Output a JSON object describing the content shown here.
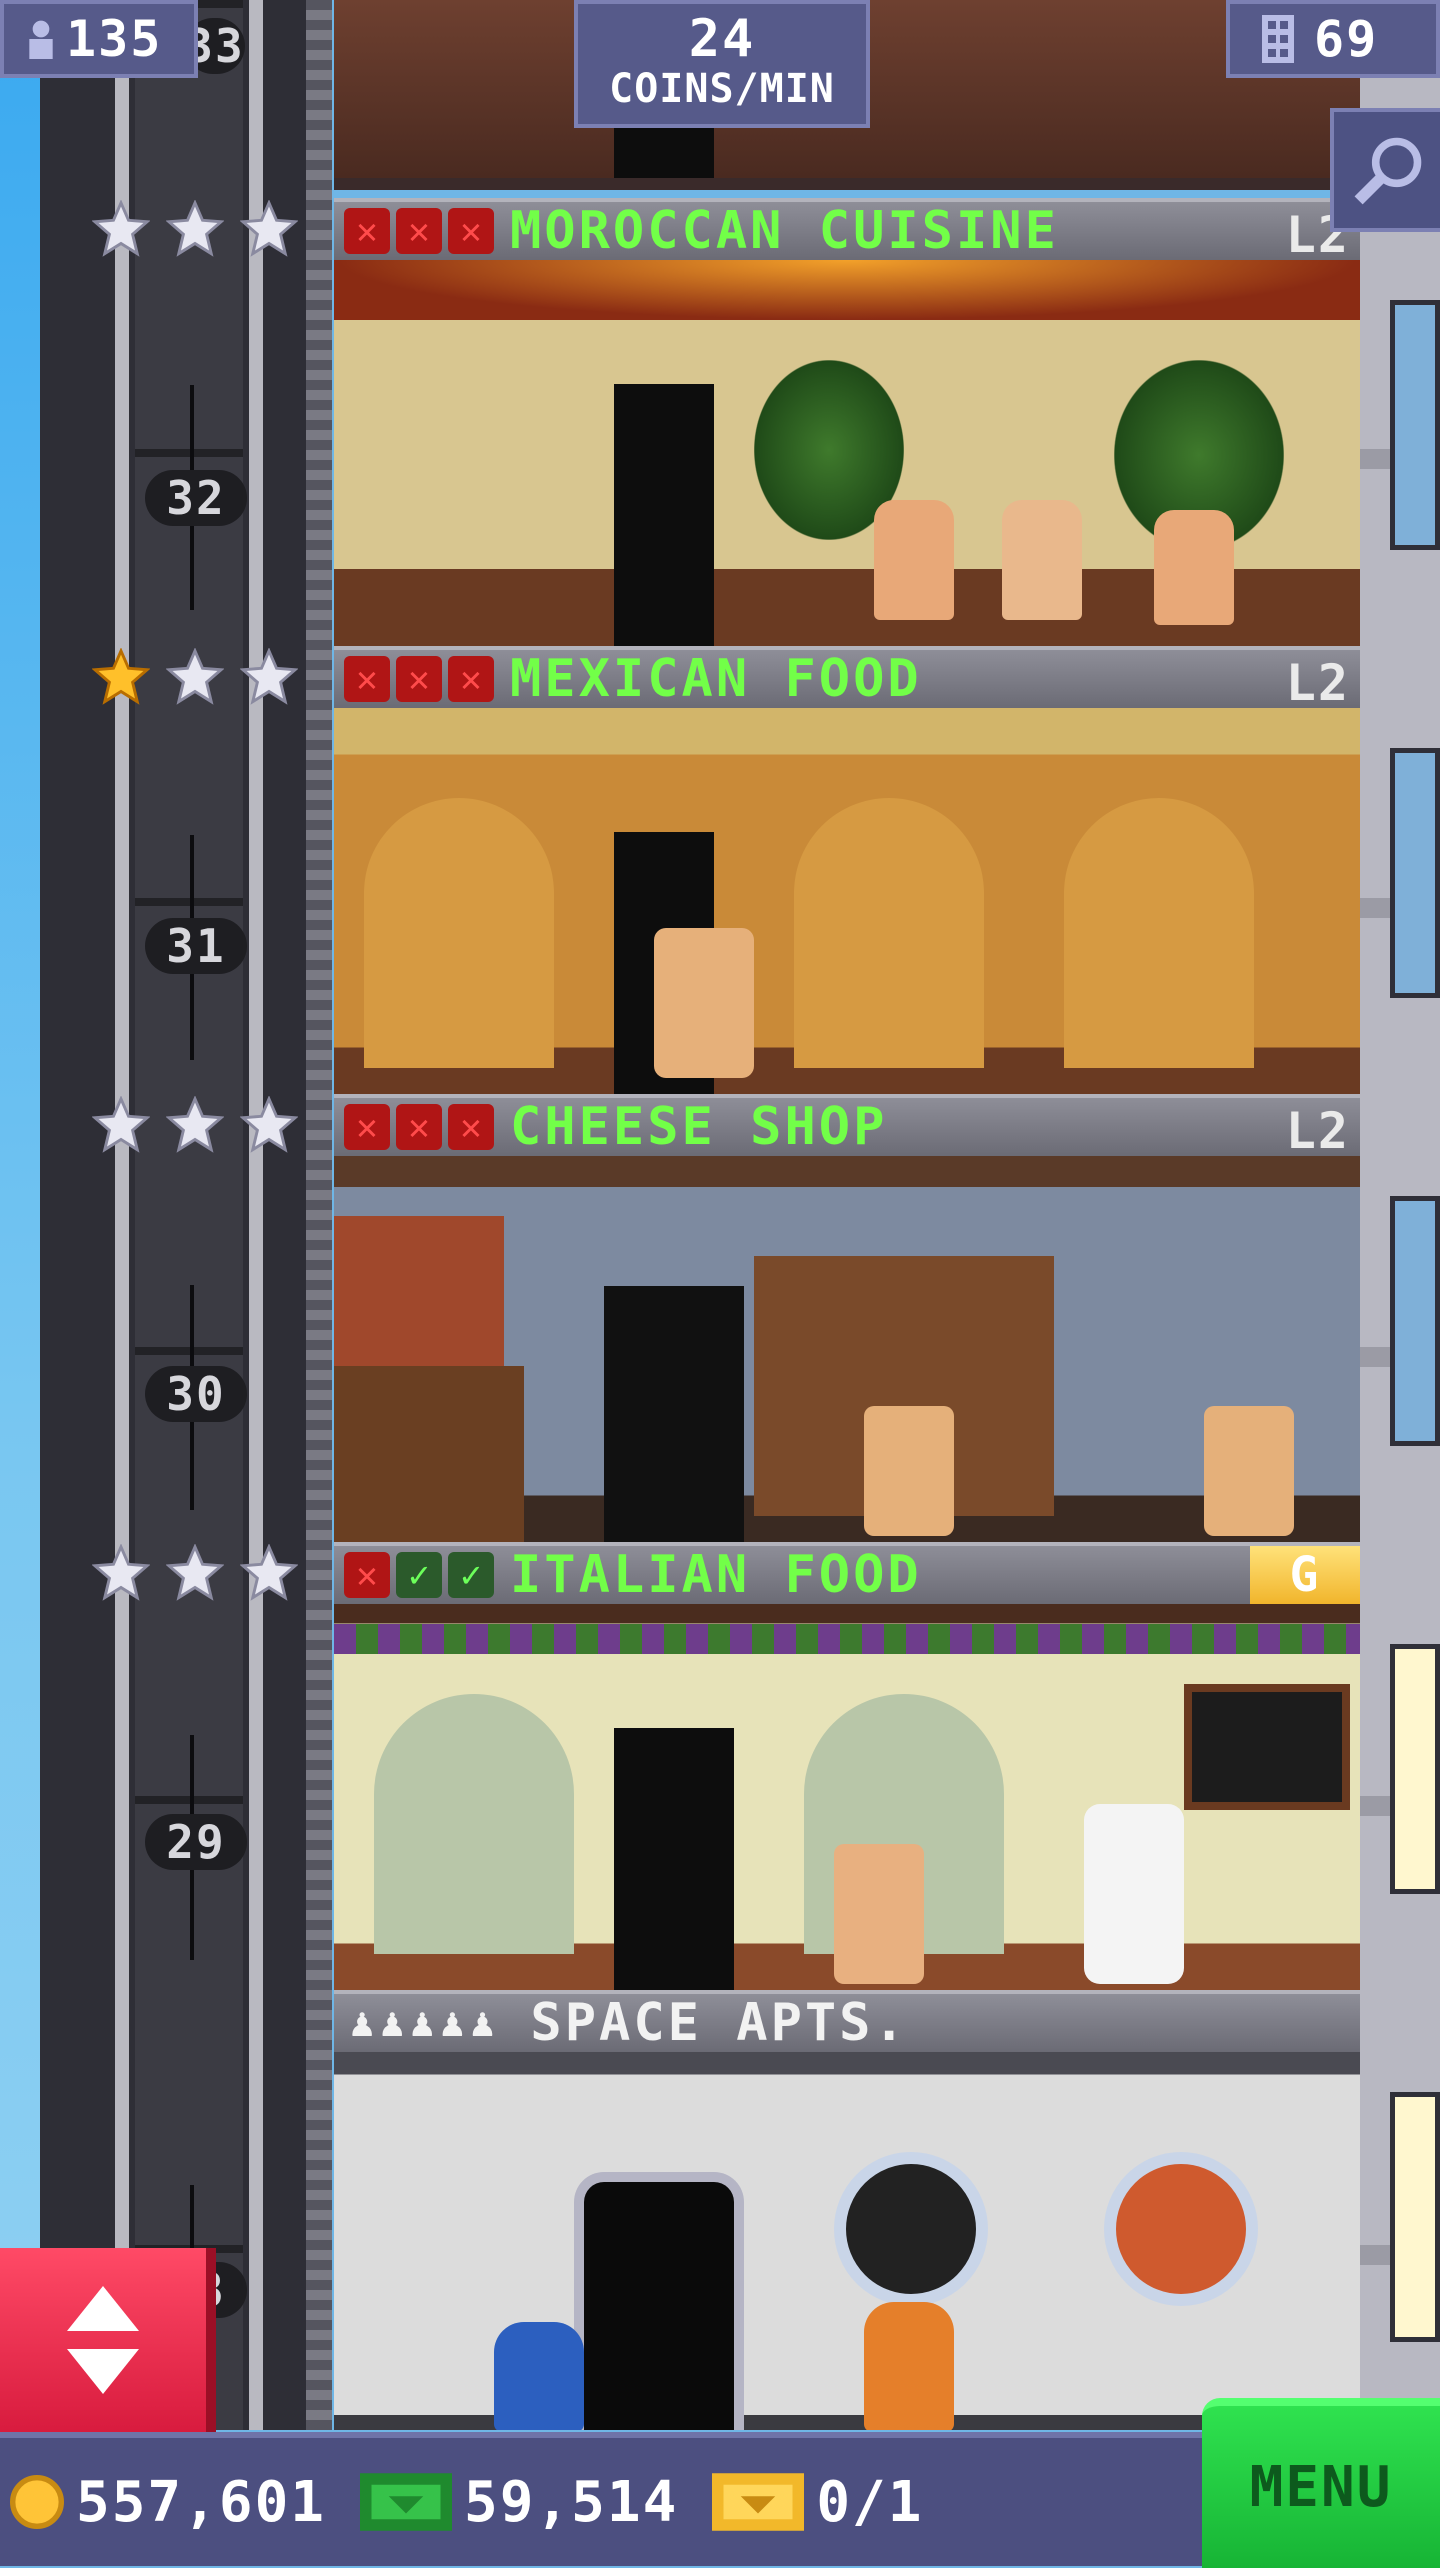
{
  "hud": {
    "population": "135",
    "coins_rate_value": "24",
    "coins_rate_unit": "COINS/MIN",
    "floors": "69"
  },
  "floors": [
    {
      "number": "32",
      "name": "MOROCCAN CUISINE",
      "level": "L2",
      "stars_gold": 0,
      "checks": [
        "x",
        "x",
        "x"
      ]
    },
    {
      "number": "31",
      "name": "MEXICAN FOOD",
      "level": "L2",
      "stars_gold": 1,
      "checks": [
        "x",
        "x",
        "x"
      ]
    },
    {
      "number": "30",
      "name": "CHEESE SHOP",
      "level": "L2",
      "stars_gold": 0,
      "checks": [
        "x",
        "x",
        "x"
      ]
    },
    {
      "number": "29",
      "name": "ITALIAN FOOD",
      "level": "G",
      "stars_gold": 0,
      "checks": [
        "x",
        "ok",
        "ok"
      ]
    },
    {
      "number": "28",
      "name": "SPACE APTS.",
      "level": "",
      "residents": 5
    }
  ],
  "partial_floor_top": "33",
  "bottom": {
    "coins": "557,601",
    "bux": "59,514",
    "tickets": "0/1",
    "menu_label": "MENU"
  },
  "icons": {
    "population": "person-icon",
    "floors": "building-icon",
    "search": "magnifier-icon",
    "elevator": "up-down-arrows-icon",
    "coin": "coin-icon",
    "bux": "bux-icon",
    "ticket": "golden-ticket-icon"
  },
  "colors": {
    "hud_bg": "#565a8a",
    "floor_name": "#72ff48",
    "menu_green": "#2fe24f",
    "elevator_red": "#ff4a66"
  }
}
